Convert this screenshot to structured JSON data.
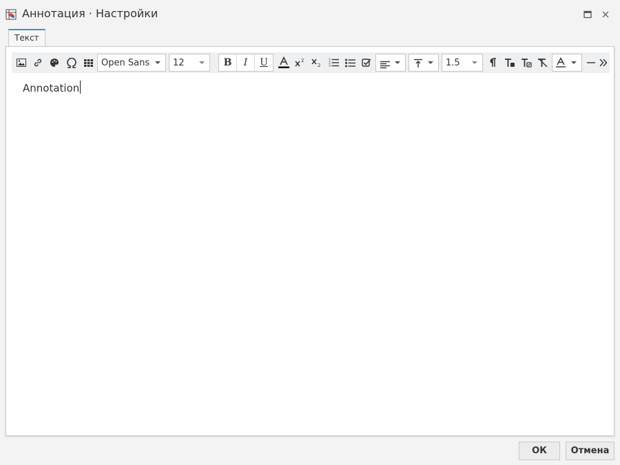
{
  "window": {
    "title": "Аннотация · Настройки",
    "app_icon": "annotation-app-icon",
    "maximize_icon": "maximize-icon",
    "close_icon": "close-icon"
  },
  "tabs": [
    {
      "label": "Текст",
      "active": true
    }
  ],
  "toolbar": {
    "icons": [
      "image-icon",
      "link-icon",
      "palette-icon",
      "omega-icon",
      "table-icon"
    ],
    "font_family": "Open Sans",
    "font_size": "12",
    "bold_label": "B",
    "italic_label": "I",
    "underline_label": "U",
    "line_height": "1.5",
    "colors": {
      "text_color_underline": "#111111",
      "accent": "#3a8fd0"
    }
  },
  "editor": {
    "text": "Annotation"
  },
  "footer": {
    "ok_label": "ОК",
    "cancel_label": "Отмена"
  }
}
